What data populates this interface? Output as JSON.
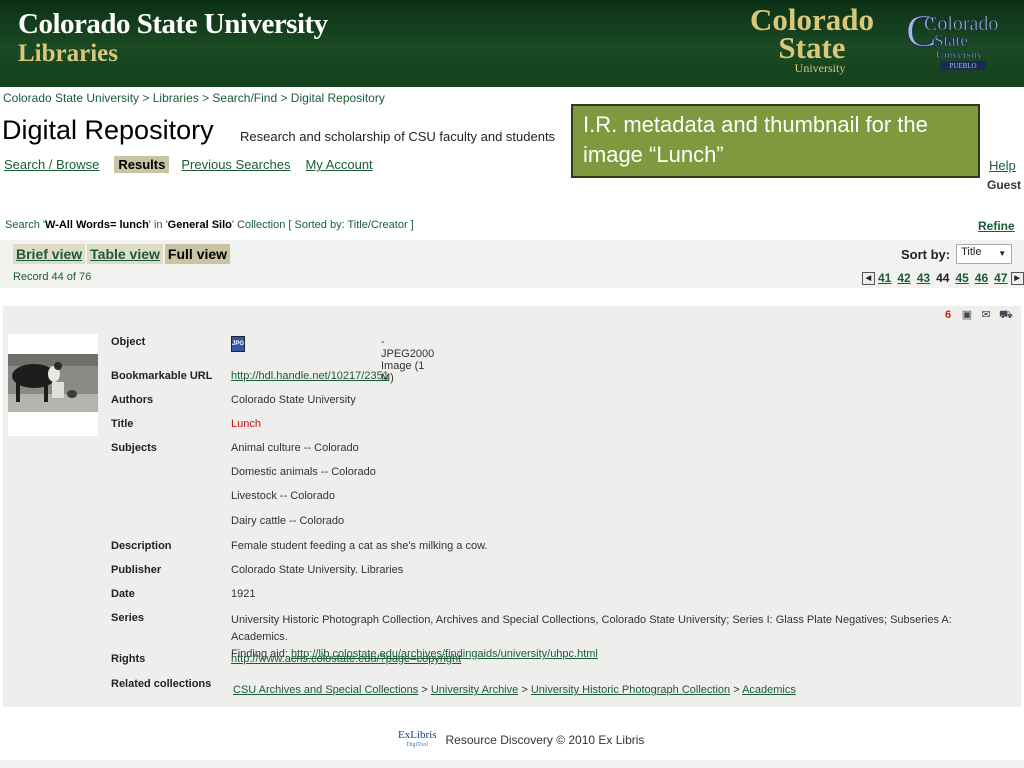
{
  "banner": {
    "title": "Colorado State University",
    "subtitle": "Libraries",
    "logo_csu": [
      "Colorado",
      "State",
      "University"
    ],
    "logo_pueblo": [
      "Colorado",
      "State",
      "University",
      "PUEBLO"
    ]
  },
  "breadcrumb": "Colorado State University > Libraries > Search/Find > Digital Repository",
  "page_title": "Digital Repository",
  "tagline": "Research and scholarship of CSU faculty and students",
  "callout": "I.R. metadata  and thumbnail for the image “Lunch”",
  "nav": {
    "search_browse": "Search / Browse",
    "results": "Results",
    "previous_searches": "Previous Searches",
    "my_account": "My Account",
    "help": "Help",
    "guest": "Guest"
  },
  "search_summary": {
    "prefix": "Search '",
    "query": "W-All Words= lunch",
    "mid": "' in '",
    "silo": "General Silo",
    "suffix": "' Collection ",
    "sorted": "[ Sorted by: Title/Creator ]",
    "refine": "Refine"
  },
  "views": {
    "brief": "Brief view",
    "table": "Table view",
    "full": "Full view"
  },
  "sort": {
    "label": "Sort by:",
    "selected": "Title"
  },
  "record_counter": "Record 44 of 76",
  "pager": {
    "pages": [
      "41",
      "42",
      "43",
      "44",
      "45",
      "46",
      "47"
    ],
    "current": "44"
  },
  "record": {
    "object_label": "Object",
    "object_icon_text": "JPG",
    "object_desc": "- JPEG2000 Image (1 M)",
    "url_label": "Bookmarkable URL",
    "url": "http://hdl.handle.net/10217/2351",
    "authors_label": "Authors",
    "authors": "Colorado State University",
    "title_label": "Title",
    "title": "Lunch",
    "subjects_label": "Subjects",
    "subjects": [
      "Animal culture -- Colorado",
      "Domestic animals -- Colorado",
      "Livestock -- Colorado",
      "Dairy cattle -- Colorado"
    ],
    "description_label": "Description",
    "description": "Female student feeding a cat as she's milking a cow.",
    "publisher_label": "Publisher",
    "publisher": "Colorado State University. Libraries",
    "date_label": "Date",
    "date": "1921",
    "series_label": "Series",
    "series": "University Historic Photograph Collection, Archives and Special Collections, Colorado State University; Series I: Glass Plate Negatives; Subseries A: Academics.",
    "finding_aid_prefix": "Finding aid: ",
    "finding_aid_url": "http://lib.colostate.edu/archives/findingaids/university/uhpc.html",
    "rights_label": "Rights",
    "rights_url": "http://www.acns.colostate.edu/?page=copyright",
    "related_label": "Related collections",
    "related": [
      "CSU Archives and Special Collections",
      "University Archive",
      "University Historic Photograph Collection",
      "Academics"
    ],
    "related_separator": ">"
  },
  "footer": {
    "logo_main": "ExLibris",
    "logo_sub": "DigiTool",
    "text": "Resource Discovery © 2010 Ex Libris"
  },
  "colors": {
    "banner_green": "#14401d",
    "link_green": "#1a5c37",
    "callout_olive": "#7f9a3e",
    "title_red": "#cc1111"
  }
}
